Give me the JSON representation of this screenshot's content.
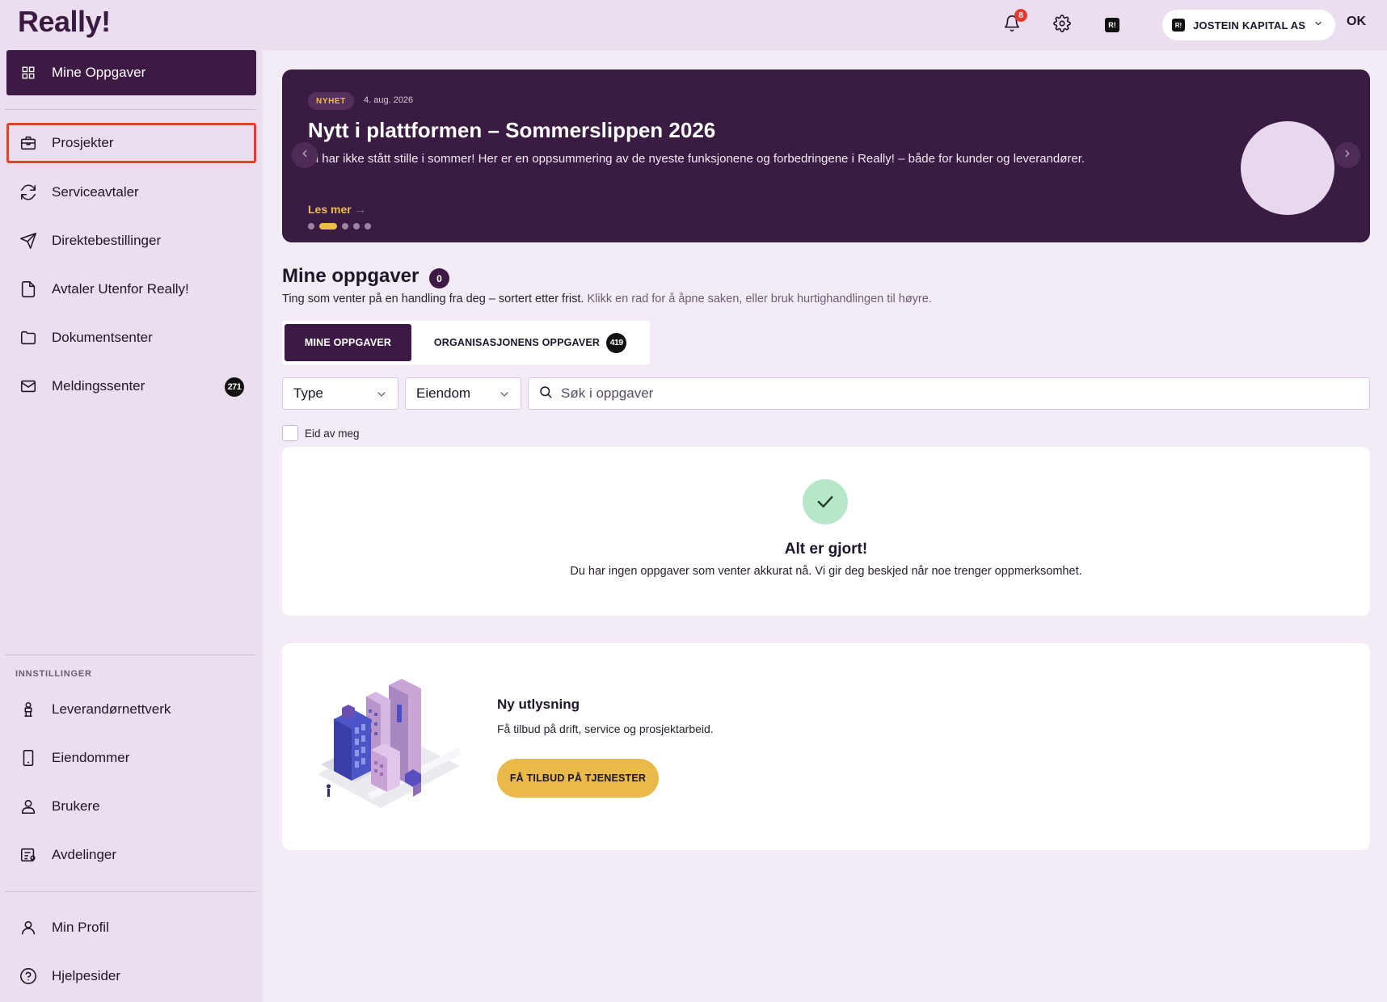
{
  "app": {
    "logo": "Really!"
  },
  "topbar": {
    "notifications_count": "8",
    "org_icon_text": "R!",
    "org_name": "JOSTEIN KAPITAL AS",
    "user_initials": "OK"
  },
  "sidebar": {
    "items": [
      {
        "label": "Mine Oppgaver",
        "icon": "grid-icon"
      },
      {
        "label": "Prosjekter",
        "icon": "briefcase-icon"
      },
      {
        "label": "Serviceavtaler",
        "icon": "refresh-icon"
      },
      {
        "label": "Direktebestillinger",
        "icon": "send-icon"
      },
      {
        "label": "Avtaler Utenfor Really!",
        "icon": "document-icon"
      },
      {
        "label": "Dokumentsenter",
        "icon": "folder-icon"
      },
      {
        "label": "Meldingssenter",
        "icon": "mail-icon",
        "badge": "271"
      }
    ],
    "settings_heading": "INNSTILLINGER",
    "settings_items": [
      {
        "label": "Leverandørnettverk",
        "icon": "supplier-icon"
      },
      {
        "label": "Eiendommer",
        "icon": "building-icon"
      },
      {
        "label": "Brukere",
        "icon": "user-icon"
      },
      {
        "label": "Avdelinger",
        "icon": "department-icon"
      }
    ],
    "bottom_items": [
      {
        "label": "Min Profil",
        "icon": "profile-icon"
      },
      {
        "label": "Hjelpesider",
        "icon": "help-icon"
      }
    ]
  },
  "hero": {
    "tag": "NYHET",
    "date": "4. aug. 2026",
    "title": "Nytt i plattformen – Sommerslippen 2026",
    "text": "Vi har ikke stått stille i sommer! Her er en oppsummering av de nyeste funksjonene og forbedringene i Really! – både for kunder og leverandører.",
    "link": "Les mer",
    "active_slide": 2,
    "slide_count": 5
  },
  "tasks": {
    "title": "Mine oppgaver",
    "count": "0",
    "subtitle": "Ting som venter på en handling fra deg – sortert etter frist.",
    "subtitle_hint": "Klikk en rad for å åpne saken, eller bruk hurtighandlingen til høyre.",
    "tabs": [
      {
        "label": "MINE OPPGAVER",
        "active": true
      },
      {
        "label": "ORGANISASJONENS OPPGAVER",
        "badge": "419",
        "active": false
      }
    ],
    "filters": {
      "type": "Type",
      "property": "Eiendom"
    },
    "search_placeholder": "Søk i oppgaver",
    "owned_by_me_label": "Eid av meg",
    "empty_title": "Alt er gjort!",
    "empty_text": "Du har ingen oppgaver som venter akkurat nå. Vi gir deg beskjed når noe trenger oppmerksomhet."
  },
  "promo": {
    "title": "Ny utlysning",
    "text": "Få tilbud på drift, service og prosjektarbeid.",
    "button": "FÅ TILBUD PÅ TJENESTER"
  },
  "colors": {
    "accent_dark": "#3c1a44",
    "accent_yellow": "#e9b949",
    "highlight_outline": "#e0422c",
    "success_circle": "#b6e7c9"
  }
}
